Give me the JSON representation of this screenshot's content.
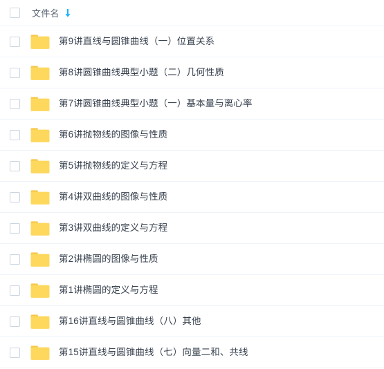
{
  "header": {
    "select_all_checkbox": "",
    "column_label": "文件名",
    "sort_icon": "sort-descending-arrow-icon",
    "sort_icon_color": "#1ab2ff"
  },
  "colors": {
    "background": "#ffffff",
    "row_separator": "#eef3fa",
    "text": "#38424f",
    "header_text": "#5a6573",
    "checkbox_border": "#ccd5e0",
    "folder_body": "#fdd85d",
    "folder_tab": "#f5c84c",
    "accent_blue": "#1ab2ff"
  },
  "rows": [
    {
      "icon": "folder-icon",
      "name": "第9讲直线与圆锥曲线（一）位置关系"
    },
    {
      "icon": "folder-icon",
      "name": "第8讲圆锥曲线典型小题（二）几何性质"
    },
    {
      "icon": "folder-icon",
      "name": "第7讲圆锥曲线典型小题（一）基本量与离心率"
    },
    {
      "icon": "folder-icon",
      "name": "第6讲抛物线的图像与性质"
    },
    {
      "icon": "folder-icon",
      "name": "第5讲抛物线的定义与方程"
    },
    {
      "icon": "folder-icon",
      "name": "第4讲双曲线的图像与性质"
    },
    {
      "icon": "folder-icon",
      "name": "第3讲双曲线的定义与方程"
    },
    {
      "icon": "folder-icon",
      "name": "第2讲椭圆的图像与性质"
    },
    {
      "icon": "folder-icon",
      "name": "第1讲椭圆的定义与方程"
    },
    {
      "icon": "folder-icon",
      "name": "第16讲直线与圆锥曲线（八）其他"
    },
    {
      "icon": "folder-icon",
      "name": "第15讲直线与圆锥曲线（七）向量二和、共线"
    }
  ]
}
